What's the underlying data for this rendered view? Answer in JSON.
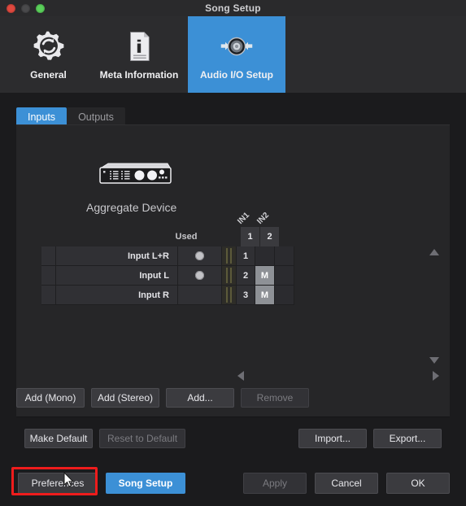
{
  "window": {
    "title": "Song Setup",
    "traffic_lights": [
      "close-button",
      "minimize-button",
      "maximize-button"
    ]
  },
  "toolbar": {
    "items": [
      {
        "label": "General",
        "icon": "gear-refresh-icon",
        "selected": false
      },
      {
        "label": "Meta Information",
        "icon": "document-info-icon",
        "selected": false
      },
      {
        "label": "Audio I/O Setup",
        "icon": "audio-io-icon",
        "selected": true
      }
    ]
  },
  "tabs": [
    {
      "label": "Inputs",
      "active": true
    },
    {
      "label": "Outputs",
      "active": false
    }
  ],
  "panel": {
    "device_name": "Aggregate Device",
    "device_icon": "audio-interface-icon",
    "table": {
      "used_header": "Used",
      "channel_labels": [
        "IN1",
        "IN2"
      ],
      "channel_numbers": [
        "1",
        "2"
      ],
      "rows": [
        {
          "name": "Input L+R",
          "used": true,
          "number": "1",
          "cells": [
            "",
            ""
          ]
        },
        {
          "name": "Input L",
          "used": true,
          "number": "2",
          "cells": [
            "M",
            ""
          ]
        },
        {
          "name": "Input R",
          "used": false,
          "number": "3",
          "cells": [
            "M",
            ""
          ]
        }
      ]
    },
    "scroll": {
      "up": "scroll-up-arrow",
      "down": "scroll-down-arrow",
      "left": "scroll-left-arrow",
      "right": "scroll-right-arrow"
    }
  },
  "add_row": {
    "add_mono": "Add (Mono)",
    "add_stereo": "Add (Stereo)",
    "add_more": "Add...",
    "remove": "Remove",
    "remove_disabled": true
  },
  "default_row": {
    "make_default": "Make Default",
    "reset_to_default": "Reset to Default",
    "reset_disabled": true,
    "import": "Import...",
    "export": "Export..."
  },
  "bottom_bar": {
    "preferences": "Preferences",
    "song_setup": "Song Setup",
    "apply": "Apply",
    "apply_disabled": true,
    "cancel": "Cancel",
    "ok": "OK"
  },
  "annotation": {
    "highlight_target": "preferences-button",
    "highlight_color": "#ee1c1c",
    "cursor": "mouse-pointer"
  },
  "colors": {
    "accent": "#3c90d6",
    "window_bg": "#1b1b1d",
    "panel_bg": "#262628",
    "toolbar_bg": "#2c2c2e",
    "row_bg": "#303034",
    "cell_on": "#8e9196"
  }
}
